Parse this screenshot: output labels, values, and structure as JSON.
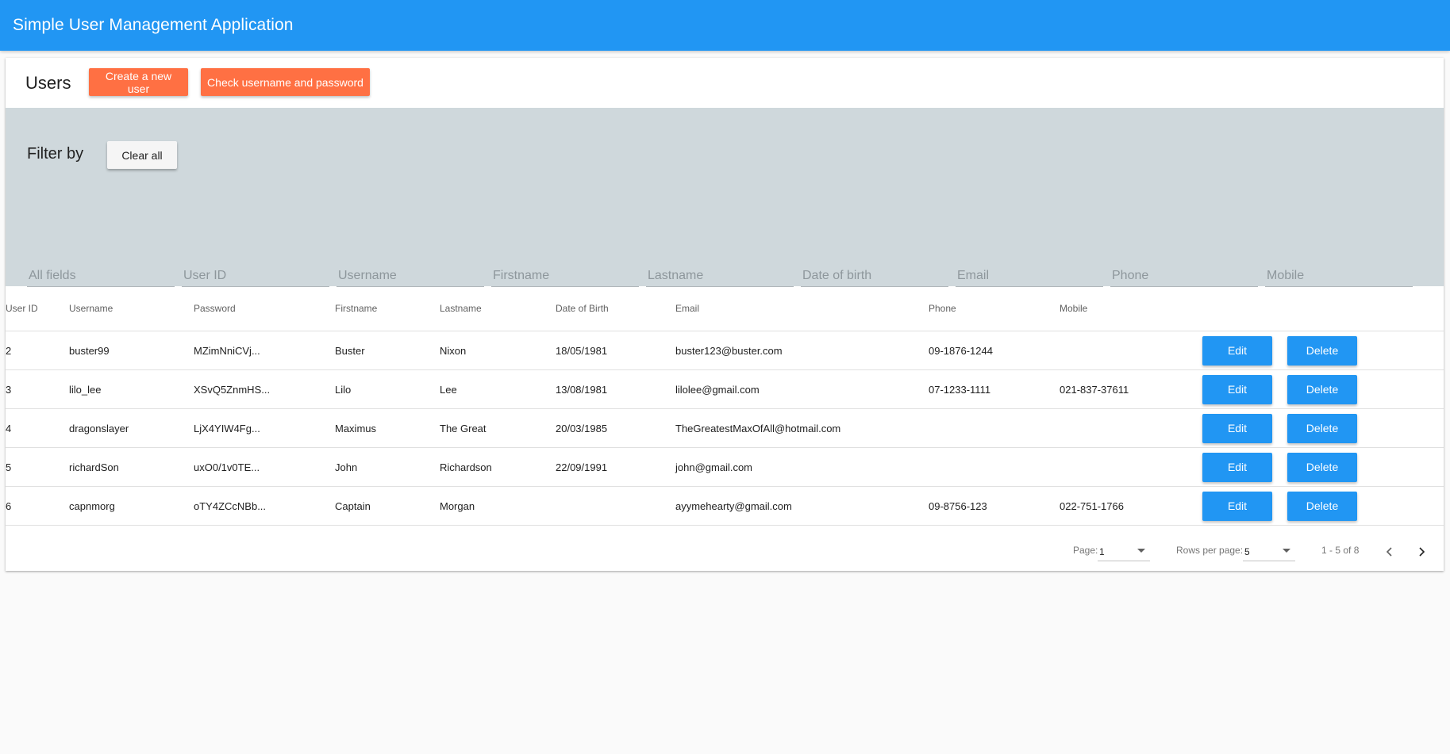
{
  "app": {
    "title": "Simple User Management Application"
  },
  "header": {
    "title": "Users",
    "create_button": "Create a new user",
    "check_button": "Check username and password"
  },
  "filter": {
    "title": "Filter by",
    "clear_button": "Clear all",
    "fields": [
      "All fields",
      "User ID",
      "Username",
      "Firstname",
      "Lastname",
      "Date of birth",
      "Email",
      "Phone",
      "Mobile"
    ]
  },
  "table": {
    "columns": [
      "User ID",
      "Username",
      "Password",
      "Firstname",
      "Lastname",
      "Date of Birth",
      "Email",
      "Phone",
      "Mobile"
    ],
    "edit_label": "Edit",
    "delete_label": "Delete",
    "rows": [
      [
        "2",
        "buster99",
        "MZimNniCVj...",
        "Buster",
        "Nixon",
        "18/05/1981",
        "buster123@buster.com",
        "09-1876-1244",
        ""
      ],
      [
        "3",
        "lilo_lee",
        "XSvQ5ZnmHS...",
        "Lilo",
        "Lee",
        "13/08/1981",
        "lilolee@gmail.com",
        "07-1233-1111",
        "021-837-37611"
      ],
      [
        "4",
        "dragonslayer",
        "LjX4YIW4Fg...",
        "Maximus",
        "The Great",
        "20/03/1985",
        "TheGreatestMaxOfAll@hotmail.com",
        "",
        ""
      ],
      [
        "5",
        "richardSon",
        "uxO0/1v0TE...",
        "John",
        "Richardson",
        "22/09/1991",
        "john@gmail.com",
        "",
        ""
      ],
      [
        "6",
        "capnmorg",
        "oTY4ZCcNBb...",
        "Captain",
        "Morgan",
        "",
        "ayymehearty@gmail.com",
        "09-8756-123",
        "022-751-1766"
      ]
    ]
  },
  "pagination": {
    "page_label": "Page:",
    "page_value": "1",
    "rows_label": "Rows per page:",
    "rows_value": "5",
    "range": "1 - 5 of 8"
  },
  "colors": {
    "primary": "#2196f3",
    "accent": "#ff7043",
    "filter_bg": "#cfd8dc"
  },
  "icons": {
    "prev": "chevron-left-icon",
    "next": "chevron-right-icon",
    "dropdown": "caret-down-icon"
  }
}
